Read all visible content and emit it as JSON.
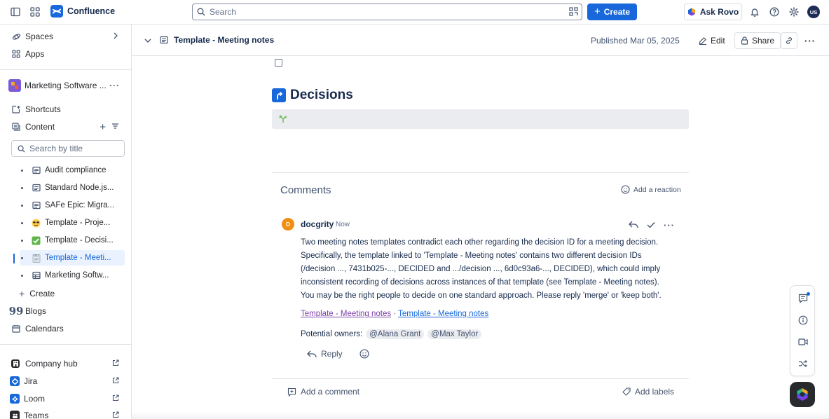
{
  "topbar": {
    "app_name": "Confluence",
    "search_placeholder": "Search",
    "create_label": "Create",
    "ask_rovo_label": "Ask Rovo",
    "user_initials": "US"
  },
  "sidebar": {
    "spaces_label": "Spaces",
    "apps_label": "Apps",
    "space_name": "Marketing Software ...",
    "shortcuts_label": "Shortcuts",
    "content_label": "Content",
    "search_placeholder": "Search by title",
    "tree": [
      {
        "label": "Audit compliance",
        "icon": "page-icon"
      },
      {
        "label": "Standard Node.js...",
        "icon": "page-icon"
      },
      {
        "label": "SAFe Epic: Migra...",
        "icon": "page-icon"
      },
      {
        "label": "Template - Proje...",
        "icon": "sunglasses-emoji-icon"
      },
      {
        "label": "Template - Decisi...",
        "icon": "check-mark-emoji-icon"
      },
      {
        "label": "Template - Meeti...",
        "icon": "notepad-emoji-icon",
        "active": true
      },
      {
        "label": "Marketing Softw...",
        "icon": "database-icon"
      }
    ],
    "create_label": "Create",
    "blogs_label": "Blogs",
    "calendars_label": "Calendars",
    "apps_list": [
      {
        "label": "Company hub",
        "icon": "company-hub-icon"
      },
      {
        "label": "Jira",
        "icon": "jira-icon"
      },
      {
        "label": "Loom",
        "icon": "loom-icon"
      },
      {
        "label": "Teams",
        "icon": "teams-icon"
      }
    ]
  },
  "header": {
    "page_title": "Template - Meeting notes",
    "published": "Published Mar 05, 2025",
    "edit_label": "Edit",
    "share_label": "Share"
  },
  "content": {
    "decisions_heading": "Decisions"
  },
  "comments": {
    "heading": "Comments",
    "add_reaction": "Add a reaction",
    "author": "docgrity",
    "author_initial": "D",
    "time": "Now",
    "body": [
      "Two meeting notes templates contradict each other regarding the decision ID for a meeting decision.",
      "Specifically, the template linked to 'Template - Meeting notes' contains two different decision IDs",
      "(/decision ..., 7431b025-..., DECIDED and .../decision ..., 6d0c93a6-..., DECIDED), which could imply",
      "inconsistent recording of decisions across instances of that template (see Template - Meeting notes).",
      "You may be the right people to decide on one standard approach. Please reply 'merge' or 'keep both'."
    ],
    "link1": "Template - Meeting notes",
    "link_sep": " · ",
    "link2": "Template - Meeting notes",
    "owners_label": "Potential owners:",
    "owner1": "@Alana Grant",
    "owner2": "@Max Taylor",
    "reply_label": "Reply",
    "add_comment": "Add a comment",
    "add_labels": "Add labels"
  },
  "colors": {
    "brand": "#1868db",
    "visited_link": "#7b3fa8",
    "avatar_comment": "#f18d13"
  }
}
